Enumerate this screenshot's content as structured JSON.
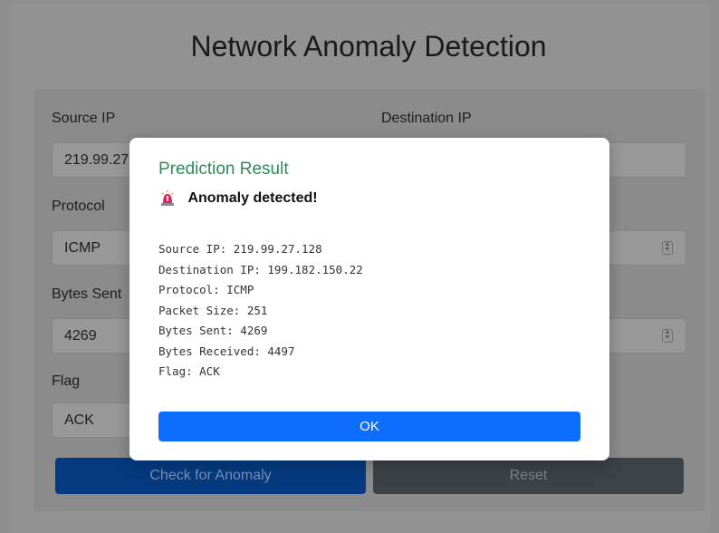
{
  "page": {
    "title": "Network Anomaly Detection"
  },
  "form": {
    "source_ip_label": "Source IP",
    "source_ip_value": "219.99.27.128",
    "destination_ip_label": "Destination IP",
    "protocol_label": "Protocol",
    "protocol_value": "ICMP",
    "bytes_sent_label": "Bytes Sent",
    "bytes_sent_value": "4269",
    "flag_label": "Flag",
    "flag_value": "ACK",
    "check_button": "Check for Anomaly",
    "reset_button": "Reset"
  },
  "modal": {
    "title": "Prediction Result",
    "alert_icon": "siren-icon",
    "alert_text": "Anomaly detected!",
    "details": [
      "Source IP: 219.99.27.128",
      "Destination IP: 199.182.150.22",
      "Protocol: ICMP",
      "Packet Size: 251",
      "Bytes Sent: 4269",
      "Bytes Received: 4497",
      "Flag: ACK"
    ],
    "ok_button": "OK"
  },
  "colors": {
    "success_title": "#2e8b57",
    "primary": "#0d6efd",
    "secondary": "#6c757d"
  }
}
